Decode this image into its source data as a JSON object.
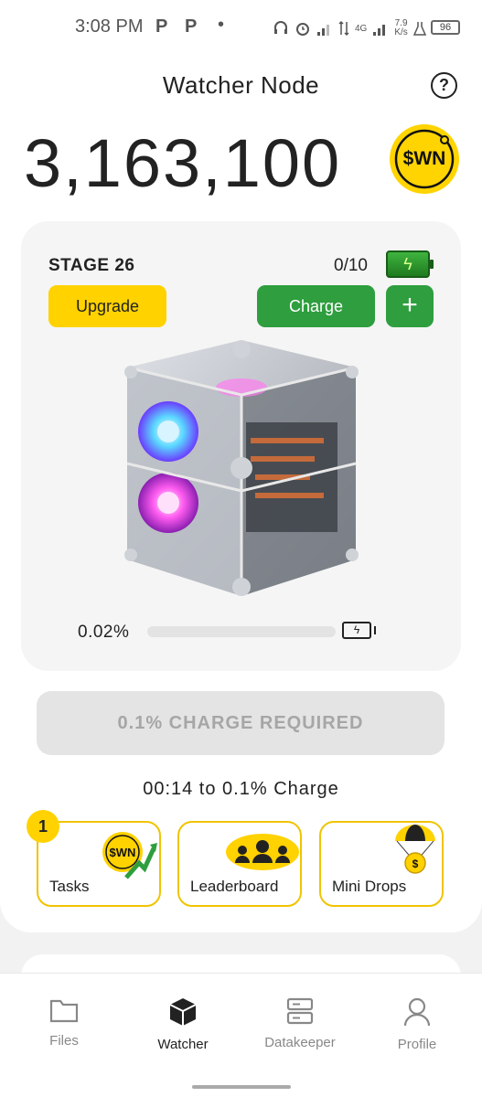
{
  "status_bar": {
    "time": "3:08 PM",
    "app_icon_1": "P",
    "app_icon_2": "P",
    "dot": "•",
    "network": "4G",
    "speed_value": "7.9",
    "speed_unit": "K/s",
    "battery": "96"
  },
  "header": {
    "title": "Watcher Node",
    "help_symbol": "?"
  },
  "balance": {
    "amount": "3,163,100",
    "token_label": "$WN"
  },
  "node_card": {
    "stage_label": "STAGE 26",
    "charges": "0/10",
    "upgrade_label": "Upgrade",
    "charge_label": "Charge",
    "plus_label": "+",
    "progress_text": "0.02%",
    "progress_value": 0.02
  },
  "charge_required_label": "0.1% CHARGE REQUIRED",
  "timer_text": "00:14 to 0.1% Charge",
  "tiles": {
    "tasks": {
      "label": "Tasks",
      "badge": "1",
      "coin_label": "$WN"
    },
    "leaderboard": {
      "label": "Leaderboard"
    },
    "mini_drops": {
      "label": "Mini Drops",
      "coin_symbol": "$"
    }
  },
  "bottom_nav": {
    "items": [
      {
        "label": "Files",
        "icon": "folder-icon"
      },
      {
        "label": "Watcher",
        "icon": "cube-icon"
      },
      {
        "label": "Datakeeper",
        "icon": "server-icon"
      },
      {
        "label": "Profile",
        "icon": "person-icon"
      }
    ],
    "active": "Watcher"
  },
  "colors": {
    "accent_yellow": "#ffd200",
    "accent_green": "#2e9e3e",
    "disabled_gray": "#e4e4e4"
  }
}
